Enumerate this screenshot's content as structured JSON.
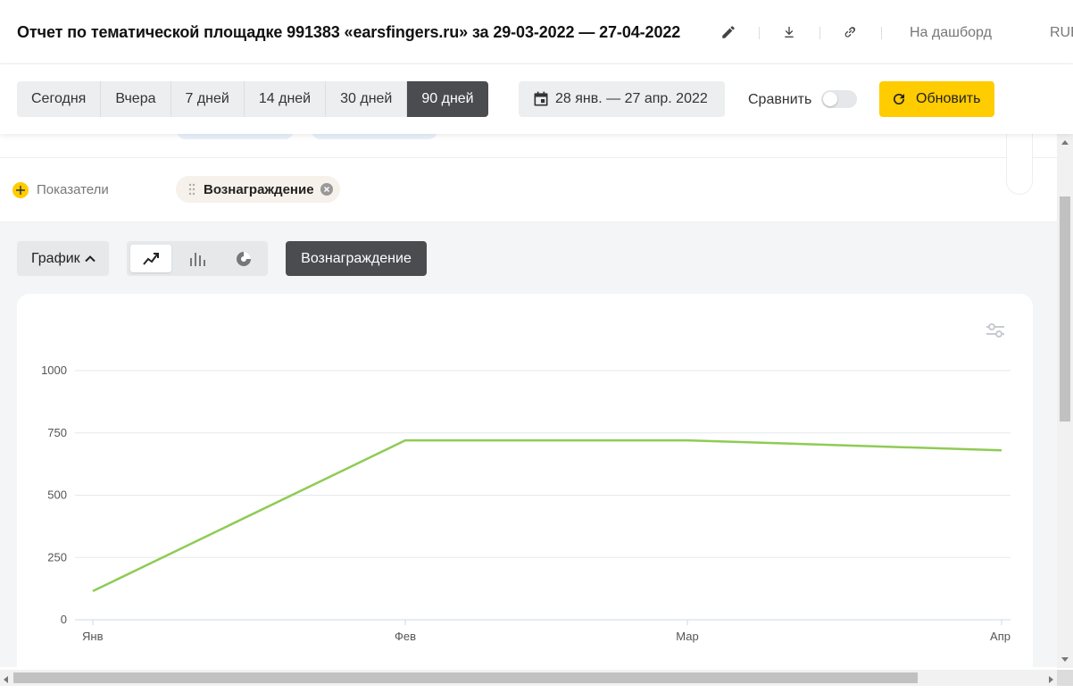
{
  "header": {
    "title": "Отчет по тематической площадке 991383 «earsfingers.ru» за 29-03-2022 — 27-04-2022",
    "dashboard_link": "На дашборд",
    "currency": "RUB",
    "icons": [
      "edit-icon",
      "download-icon",
      "link-icon"
    ]
  },
  "toolbar": {
    "periods": [
      "Сегодня",
      "Вчера",
      "7 дней",
      "14 дней",
      "30 дней",
      "90 дней"
    ],
    "active_period": "90 дней",
    "date_range": "28 янв. — 27 апр. 2022",
    "compare_label": "Сравнить",
    "compare_enabled": false,
    "refresh_label": "Обновить"
  },
  "filters": {
    "metrics_label": "Показатели",
    "metric_chip": "Вознаграждение"
  },
  "chart_controls": {
    "type_label": "График",
    "view_modes": [
      "line-chart-icon",
      "bar-chart-icon",
      "pie-chart-icon"
    ],
    "active_view": "line-chart-icon",
    "series_button": "Вознаграждение"
  },
  "colors": {
    "accent_yellow": "#ffcc00",
    "series_line": "#8fcb55",
    "active_dark": "#4a4c50"
  },
  "chart_data": {
    "type": "line",
    "x": [
      "Янв",
      "Фев",
      "Мар",
      "Апр"
    ],
    "series": [
      {
        "values": [
          115,
          720,
          720,
          680
        ]
      }
    ],
    "ylim": [
      0,
      1000
    ],
    "yticks": [
      0,
      250,
      500,
      750,
      1000
    ],
    "grid": true
  }
}
